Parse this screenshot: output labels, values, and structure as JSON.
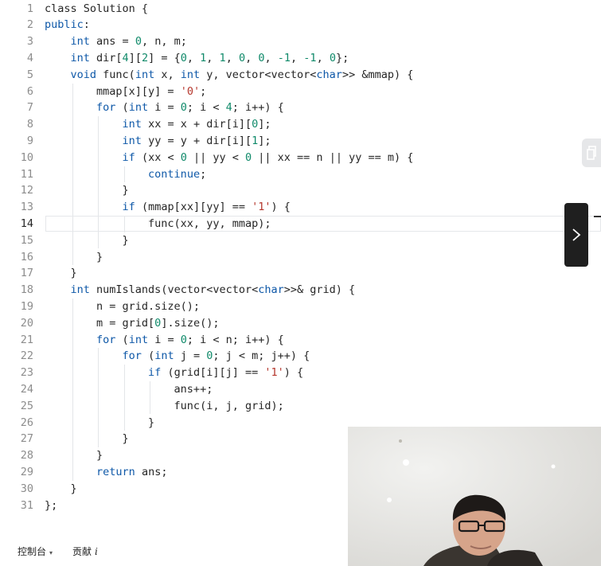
{
  "editor": {
    "active_line": 14,
    "lines": [
      {
        "n": "1",
        "tokens": [
          {
            "t": "class Solution {",
            "c": "fn"
          }
        ]
      },
      {
        "n": "2",
        "tokens": [
          {
            "t": "public",
            "c": "kw"
          },
          {
            "t": ":",
            "c": "fn"
          }
        ]
      },
      {
        "n": "3",
        "tokens": [
          {
            "t": "    ",
            "c": "fn"
          },
          {
            "t": "int",
            "c": "ty"
          },
          {
            "t": " ans = ",
            "c": "fn"
          },
          {
            "t": "0",
            "c": "num"
          },
          {
            "t": ", n, m;",
            "c": "fn"
          }
        ]
      },
      {
        "n": "4",
        "tokens": [
          {
            "t": "    ",
            "c": "fn"
          },
          {
            "t": "int",
            "c": "ty"
          },
          {
            "t": " dir[",
            "c": "fn"
          },
          {
            "t": "4",
            "c": "num"
          },
          {
            "t": "][",
            "c": "fn"
          },
          {
            "t": "2",
            "c": "num"
          },
          {
            "t": "] = {",
            "c": "fn"
          },
          {
            "t": "0",
            "c": "num"
          },
          {
            "t": ", ",
            "c": "fn"
          },
          {
            "t": "1",
            "c": "num"
          },
          {
            "t": ", ",
            "c": "fn"
          },
          {
            "t": "1",
            "c": "num"
          },
          {
            "t": ", ",
            "c": "fn"
          },
          {
            "t": "0",
            "c": "num"
          },
          {
            "t": ", ",
            "c": "fn"
          },
          {
            "t": "0",
            "c": "num"
          },
          {
            "t": ", ",
            "c": "fn"
          },
          {
            "t": "-1",
            "c": "num"
          },
          {
            "t": ", ",
            "c": "fn"
          },
          {
            "t": "-1",
            "c": "num"
          },
          {
            "t": ", ",
            "c": "fn"
          },
          {
            "t": "0",
            "c": "num"
          },
          {
            "t": "};",
            "c": "fn"
          }
        ]
      },
      {
        "n": "5",
        "tokens": [
          {
            "t": "    ",
            "c": "fn"
          },
          {
            "t": "void",
            "c": "kw"
          },
          {
            "t": " func(",
            "c": "fn"
          },
          {
            "t": "int",
            "c": "ty"
          },
          {
            "t": " x, ",
            "c": "fn"
          },
          {
            "t": "int",
            "c": "ty"
          },
          {
            "t": " y, vector<vector<",
            "c": "fn"
          },
          {
            "t": "char",
            "c": "ty"
          },
          {
            "t": ">> &mmap) {",
            "c": "fn"
          }
        ]
      },
      {
        "n": "6",
        "tokens": [
          {
            "t": "        mmap[x][y] = ",
            "c": "fn"
          },
          {
            "t": "'0'",
            "c": "str"
          },
          {
            "t": ";",
            "c": "fn"
          }
        ]
      },
      {
        "n": "7",
        "tokens": [
          {
            "t": "        ",
            "c": "fn"
          },
          {
            "t": "for",
            "c": "kw"
          },
          {
            "t": " (",
            "c": "fn"
          },
          {
            "t": "int",
            "c": "ty"
          },
          {
            "t": " i = ",
            "c": "fn"
          },
          {
            "t": "0",
            "c": "num"
          },
          {
            "t": "; i < ",
            "c": "fn"
          },
          {
            "t": "4",
            "c": "num"
          },
          {
            "t": "; i++) {",
            "c": "fn"
          }
        ]
      },
      {
        "n": "8",
        "tokens": [
          {
            "t": "            ",
            "c": "fn"
          },
          {
            "t": "int",
            "c": "ty"
          },
          {
            "t": " xx = x + dir[i][",
            "c": "fn"
          },
          {
            "t": "0",
            "c": "num"
          },
          {
            "t": "];",
            "c": "fn"
          }
        ]
      },
      {
        "n": "9",
        "tokens": [
          {
            "t": "            ",
            "c": "fn"
          },
          {
            "t": "int",
            "c": "ty"
          },
          {
            "t": " yy = y + dir[i][",
            "c": "fn"
          },
          {
            "t": "1",
            "c": "num"
          },
          {
            "t": "];",
            "c": "fn"
          }
        ]
      },
      {
        "n": "10",
        "tokens": [
          {
            "t": "            ",
            "c": "fn"
          },
          {
            "t": "if",
            "c": "kw"
          },
          {
            "t": " (xx < ",
            "c": "fn"
          },
          {
            "t": "0",
            "c": "num"
          },
          {
            "t": " || yy < ",
            "c": "fn"
          },
          {
            "t": "0",
            "c": "num"
          },
          {
            "t": " || xx == n || yy == m) {",
            "c": "fn"
          }
        ]
      },
      {
        "n": "11",
        "tokens": [
          {
            "t": "                ",
            "c": "fn"
          },
          {
            "t": "continue",
            "c": "kw"
          },
          {
            "t": ";",
            "c": "fn"
          }
        ]
      },
      {
        "n": "12",
        "tokens": [
          {
            "t": "            }",
            "c": "fn"
          }
        ]
      },
      {
        "n": "13",
        "tokens": [
          {
            "t": "            ",
            "c": "fn"
          },
          {
            "t": "if",
            "c": "kw"
          },
          {
            "t": " (mmap[xx][yy] == ",
            "c": "fn"
          },
          {
            "t": "'1'",
            "c": "str"
          },
          {
            "t": ") {",
            "c": "fn"
          }
        ]
      },
      {
        "n": "14",
        "tokens": [
          {
            "t": "                func(xx, yy, mmap);",
            "c": "fn"
          }
        ]
      },
      {
        "n": "15",
        "tokens": [
          {
            "t": "            }",
            "c": "fn"
          }
        ]
      },
      {
        "n": "16",
        "tokens": [
          {
            "t": "        }",
            "c": "fn"
          }
        ]
      },
      {
        "n": "17",
        "tokens": [
          {
            "t": "    }",
            "c": "fn"
          }
        ]
      },
      {
        "n": "18",
        "tokens": [
          {
            "t": "    ",
            "c": "fn"
          },
          {
            "t": "int",
            "c": "ty"
          },
          {
            "t": " numIslands(vector<vector<",
            "c": "fn"
          },
          {
            "t": "char",
            "c": "ty"
          },
          {
            "t": ">>& grid) {",
            "c": "fn"
          }
        ]
      },
      {
        "n": "19",
        "tokens": [
          {
            "t": "        n = grid.size();",
            "c": "fn"
          }
        ]
      },
      {
        "n": "20",
        "tokens": [
          {
            "t": "        m = grid[",
            "c": "fn"
          },
          {
            "t": "0",
            "c": "num"
          },
          {
            "t": "].size();",
            "c": "fn"
          }
        ]
      },
      {
        "n": "21",
        "tokens": [
          {
            "t": "        ",
            "c": "fn"
          },
          {
            "t": "for",
            "c": "kw"
          },
          {
            "t": " (",
            "c": "fn"
          },
          {
            "t": "int",
            "c": "ty"
          },
          {
            "t": " i = ",
            "c": "fn"
          },
          {
            "t": "0",
            "c": "num"
          },
          {
            "t": "; i < n; i++) {",
            "c": "fn"
          }
        ]
      },
      {
        "n": "22",
        "tokens": [
          {
            "t": "            ",
            "c": "fn"
          },
          {
            "t": "for",
            "c": "kw"
          },
          {
            "t": " (",
            "c": "fn"
          },
          {
            "t": "int",
            "c": "ty"
          },
          {
            "t": " j = ",
            "c": "fn"
          },
          {
            "t": "0",
            "c": "num"
          },
          {
            "t": "; j < m; j++) {",
            "c": "fn"
          }
        ]
      },
      {
        "n": "23",
        "tokens": [
          {
            "t": "                ",
            "c": "fn"
          },
          {
            "t": "if",
            "c": "kw"
          },
          {
            "t": " (grid[i][j] == ",
            "c": "fn"
          },
          {
            "t": "'1'",
            "c": "str"
          },
          {
            "t": ") {",
            "c": "fn"
          }
        ]
      },
      {
        "n": "24",
        "tokens": [
          {
            "t": "                    ans++;",
            "c": "fn"
          }
        ]
      },
      {
        "n": "25",
        "tokens": [
          {
            "t": "                    func(i, j, grid);",
            "c": "fn"
          }
        ]
      },
      {
        "n": "26",
        "tokens": [
          {
            "t": "                }",
            "c": "fn"
          }
        ]
      },
      {
        "n": "27",
        "tokens": [
          {
            "t": "            }",
            "c": "fn"
          }
        ]
      },
      {
        "n": "28",
        "tokens": [
          {
            "t": "        }",
            "c": "fn"
          }
        ]
      },
      {
        "n": "29",
        "tokens": [
          {
            "t": "        ",
            "c": "fn"
          },
          {
            "t": "return",
            "c": "kw"
          },
          {
            "t": " ans;",
            "c": "fn"
          }
        ]
      },
      {
        "n": "30",
        "tokens": [
          {
            "t": "    }",
            "c": "fn"
          }
        ]
      },
      {
        "n": "31",
        "tokens": [
          {
            "t": "};",
            "c": "fn"
          }
        ]
      }
    ]
  },
  "bottom_bar": {
    "console_label": "控制台",
    "contribute_label": "贡献",
    "info_glyph": "i"
  },
  "icons": {
    "right_tab": "copy-icon",
    "expand": "chevron-right-icon",
    "console_caret": "caret-down-icon"
  },
  "colors": {
    "keyword": "#0e58a8",
    "number": "#108a6a",
    "string": "#b5372d",
    "text": "#262626"
  }
}
